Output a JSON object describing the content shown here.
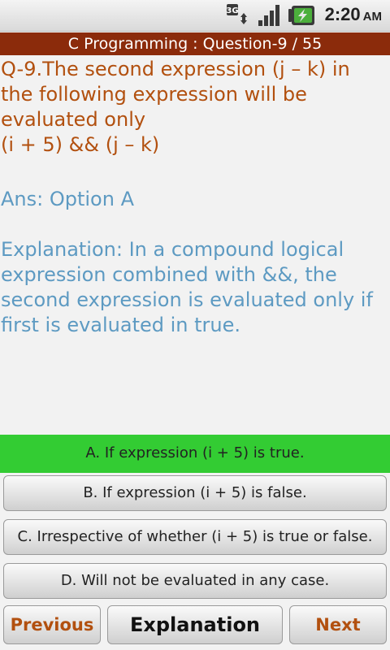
{
  "status_bar": {
    "network_label": "3G",
    "time": "2:20",
    "ampm": "AM",
    "icons": [
      "network-3g-icon",
      "signal-icon",
      "battery-charging-icon"
    ]
  },
  "title_bar": {
    "title": "C Programming : Question-9 / 55"
  },
  "question": {
    "text": "Q-9.The second expression (j – k) in the following expression will be evaluated only\n(i + 5) && (j – k)"
  },
  "answer": {
    "text": "Ans: Option A"
  },
  "explanation": {
    "text": "Explanation: In a compound logical expression combined with &&, the second expression is evaluated only if first is evaluated in true."
  },
  "options": [
    {
      "label": "A. If expression (i + 5) is true.",
      "selected": true
    },
    {
      "label": "B. If expression (i + 5) is false.",
      "selected": false
    },
    {
      "label": "C. Irrespective of whether (i + 5) is true or false.",
      "selected": false
    },
    {
      "label": "D. Will not be evaluated in any case.",
      "selected": false
    }
  ],
  "navigation": {
    "previous_label": "Previous",
    "explanation_label": "Explanation",
    "next_label": "Next"
  },
  "colors": {
    "title_bar": "#8b2b0b",
    "question_text": "#b2500f",
    "answer_text": "#5d9ac2",
    "selected_option": "#33cc33",
    "nav_accent": "#b2500f"
  }
}
